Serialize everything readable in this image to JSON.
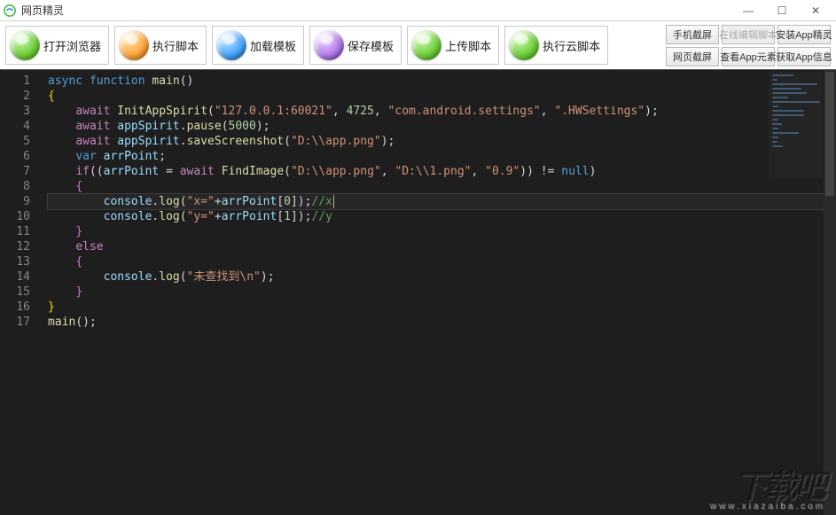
{
  "window": {
    "title": "网页精灵"
  },
  "toolbar": {
    "main_buttons": [
      {
        "label": "打开浏览器",
        "orb": "green"
      },
      {
        "label": "执行脚本",
        "orb": "orange"
      },
      {
        "label": "加载模板",
        "orb": "blue"
      },
      {
        "label": "保存模板",
        "orb": "purple"
      },
      {
        "label": "上传脚本",
        "orb": "green"
      },
      {
        "label": "执行云脚本",
        "orb": "green"
      }
    ],
    "side_buttons": [
      {
        "label": "手机截屏",
        "disabled": false
      },
      {
        "label": "在线编辑脚本",
        "disabled": true
      },
      {
        "label": "安装App精灵",
        "disabled": false
      },
      {
        "label": "网页截屏",
        "disabled": false
      },
      {
        "label": "查看App元素",
        "disabled": false
      },
      {
        "label": "获取App信息",
        "disabled": false
      }
    ]
  },
  "editor": {
    "active_line": 9,
    "lines": [
      {
        "n": 1,
        "indent": 0,
        "tokens": [
          [
            "kw",
            "async"
          ],
          [
            "sp",
            " "
          ],
          [
            "kw",
            "function"
          ],
          [
            "sp",
            " "
          ],
          [
            "fn",
            "main"
          ],
          [
            "op",
            "()"
          ]
        ]
      },
      {
        "n": 2,
        "indent": 0,
        "tokens": [
          [
            "brace",
            "{"
          ]
        ]
      },
      {
        "n": 3,
        "indent": 1,
        "tokens": [
          [
            "ctrl",
            "await"
          ],
          [
            "sp",
            " "
          ],
          [
            "fn",
            "InitAppSpirit"
          ],
          [
            "op",
            "("
          ],
          [
            "str",
            "\"127.0.0.1:60021\""
          ],
          [
            "op",
            ", "
          ],
          [
            "num",
            "4725"
          ],
          [
            "op",
            ", "
          ],
          [
            "str",
            "\"com.android.settings\""
          ],
          [
            "op",
            ", "
          ],
          [
            "str",
            "\".HWSettings\""
          ],
          [
            "op",
            ");"
          ]
        ]
      },
      {
        "n": 4,
        "indent": 1,
        "tokens": [
          [
            "ctrl",
            "await"
          ],
          [
            "sp",
            " "
          ],
          [
            "var",
            "appSpirit"
          ],
          [
            "op",
            "."
          ],
          [
            "fn",
            "pause"
          ],
          [
            "op",
            "("
          ],
          [
            "num",
            "5000"
          ],
          [
            "op",
            ");"
          ]
        ]
      },
      {
        "n": 5,
        "indent": 1,
        "tokens": [
          [
            "ctrl",
            "await"
          ],
          [
            "sp",
            " "
          ],
          [
            "var",
            "appSpirit"
          ],
          [
            "op",
            "."
          ],
          [
            "fn",
            "saveScreenshot"
          ],
          [
            "op",
            "("
          ],
          [
            "str",
            "\"D:\\\\app.png\""
          ],
          [
            "op",
            ");"
          ]
        ]
      },
      {
        "n": 6,
        "indent": 1,
        "tokens": [
          [
            "kw",
            "var"
          ],
          [
            "sp",
            " "
          ],
          [
            "var",
            "arrPoint"
          ],
          [
            "op",
            ";"
          ]
        ]
      },
      {
        "n": 7,
        "indent": 1,
        "tokens": [
          [
            "ctrl",
            "if"
          ],
          [
            "op",
            "(("
          ],
          [
            "var",
            "arrPoint"
          ],
          [
            "op",
            " = "
          ],
          [
            "ctrl",
            "await"
          ],
          [
            "sp",
            " "
          ],
          [
            "fn",
            "FindImage"
          ],
          [
            "op",
            "("
          ],
          [
            "str",
            "\"D:\\\\app.png\""
          ],
          [
            "op",
            ", "
          ],
          [
            "str",
            "\"D:\\\\1.png\""
          ],
          [
            "op",
            ", "
          ],
          [
            "str",
            "\"0.9\""
          ],
          [
            "op",
            ")) != "
          ],
          [
            "null",
            "null"
          ],
          [
            "op",
            ")"
          ]
        ]
      },
      {
        "n": 8,
        "indent": 1,
        "tokens": [
          [
            "brace2",
            "{"
          ]
        ]
      },
      {
        "n": 9,
        "indent": 2,
        "tokens": [
          [
            "var",
            "console"
          ],
          [
            "op",
            "."
          ],
          [
            "fn",
            "log"
          ],
          [
            "op",
            "("
          ],
          [
            "str",
            "\"x=\""
          ],
          [
            "op",
            "+"
          ],
          [
            "var",
            "arrPoint"
          ],
          [
            "op",
            "["
          ],
          [
            "num",
            "0"
          ],
          [
            "op",
            "]);"
          ],
          [
            "cmt",
            "//x"
          ],
          [
            "cursor",
            ""
          ]
        ]
      },
      {
        "n": 10,
        "indent": 2,
        "tokens": [
          [
            "var",
            "console"
          ],
          [
            "op",
            "."
          ],
          [
            "fn",
            "log"
          ],
          [
            "op",
            "("
          ],
          [
            "str",
            "\"y=\""
          ],
          [
            "op",
            "+"
          ],
          [
            "var",
            "arrPoint"
          ],
          [
            "op",
            "["
          ],
          [
            "num",
            "1"
          ],
          [
            "op",
            "]);"
          ],
          [
            "cmt",
            "//y"
          ]
        ]
      },
      {
        "n": 11,
        "indent": 1,
        "tokens": [
          [
            "brace2",
            "}"
          ]
        ]
      },
      {
        "n": 12,
        "indent": 1,
        "tokens": [
          [
            "ctrl",
            "else"
          ]
        ]
      },
      {
        "n": 13,
        "indent": 1,
        "tokens": [
          [
            "brace2",
            "{"
          ]
        ]
      },
      {
        "n": 14,
        "indent": 2,
        "tokens": [
          [
            "var",
            "console"
          ],
          [
            "op",
            "."
          ],
          [
            "fn",
            "log"
          ],
          [
            "op",
            "("
          ],
          [
            "str",
            "\"未查找到\\n\""
          ],
          [
            "op",
            ");"
          ]
        ]
      },
      {
        "n": 15,
        "indent": 1,
        "tokens": [
          [
            "brace2",
            "}"
          ]
        ]
      },
      {
        "n": 16,
        "indent": 0,
        "tokens": [
          [
            "brace",
            "}"
          ]
        ]
      },
      {
        "n": 17,
        "indent": 0,
        "tokens": [
          [
            "fn",
            "main"
          ],
          [
            "op",
            "();"
          ]
        ]
      }
    ]
  },
  "watermark": {
    "big": "下载吧",
    "small": "www.xiazaiba.com"
  }
}
